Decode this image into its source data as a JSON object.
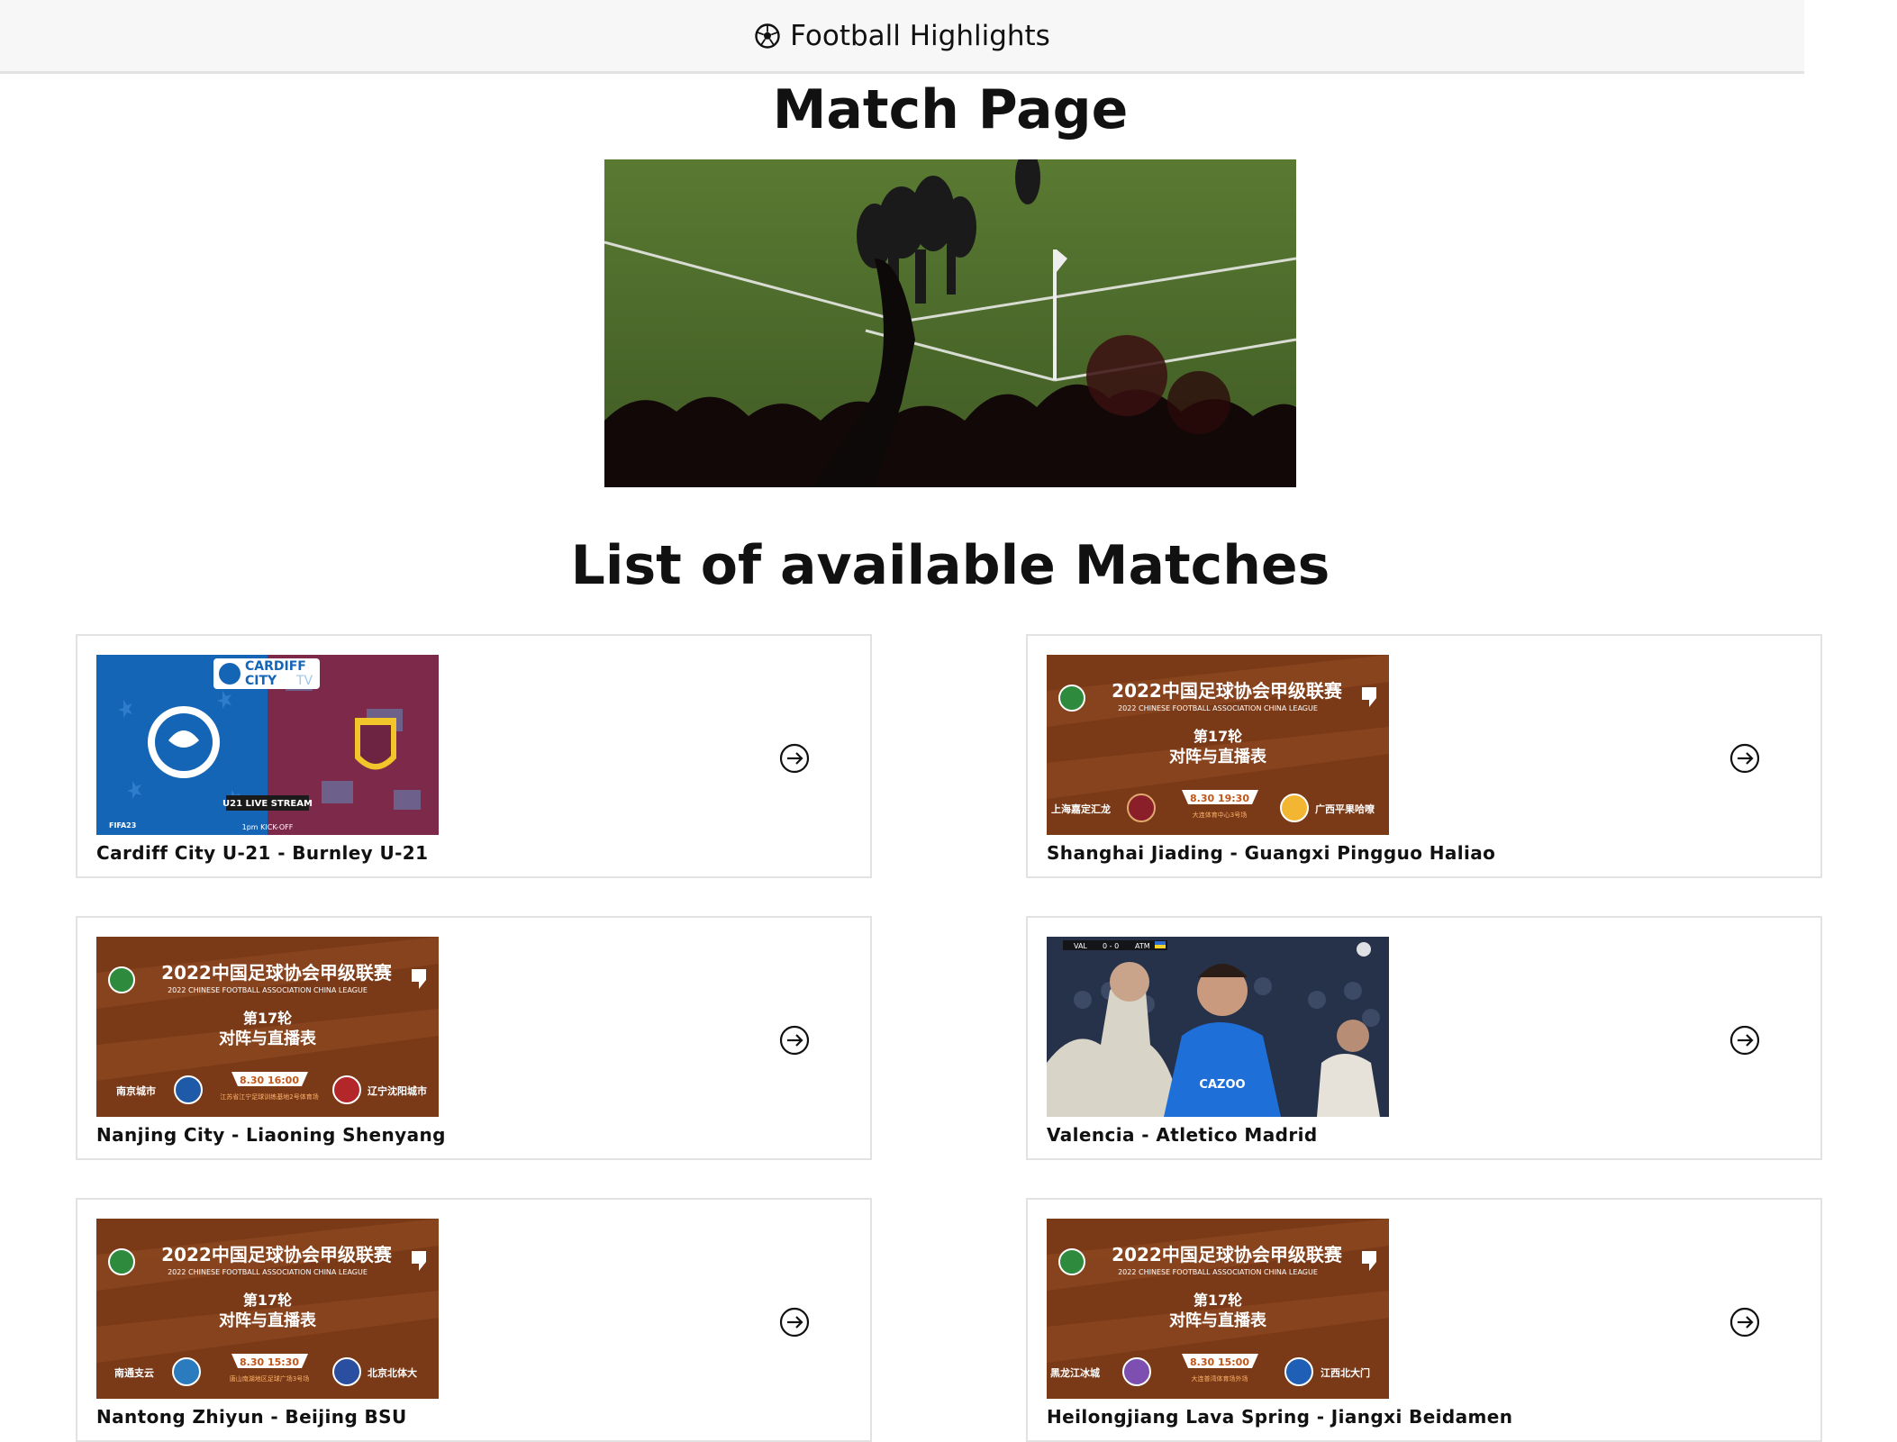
{
  "header": {
    "title": "Football Highlights",
    "logo_icon": "football-icon"
  },
  "page_title": "Match Page",
  "list_title": "List of available Matches",
  "league_banner": {
    "cn_title": "2022中国足球协会甲级联赛",
    "en_title": "2022 CHINESE FOOTBALL ASSOCIATION CHINA LEAGUE",
    "round": "第17轮",
    "subtitle": "对阵与直播表"
  },
  "matches": [
    {
      "name": "Cardiff City U-21 - Burnley U-21",
      "thumb": {
        "brand_line1": "CARDIFF",
        "brand_line2": "CITY",
        "brand_tv": "TV",
        "stream_label": "U21 LIVE STREAM",
        "kickoff": "1pm KICK-OFF",
        "sponsor": "FIFA23"
      }
    },
    {
      "name": "Shanghai Jiading - Guangxi Pingguo Haliao",
      "thumb": {
        "home": "上海嘉定汇龙",
        "away": "广西平果哈嘹",
        "time": "8.30  19:30",
        "venue": "大连体育中心3号场"
      }
    },
    {
      "name": "Nanjing City - Liaoning Shenyang",
      "thumb": {
        "home": "南京城市",
        "away": "辽宁沈阳城市",
        "time": "8.30  16:00",
        "venue": "江苏省江宁足球训练基地2号体育场"
      }
    },
    {
      "name": "Valencia - Atletico Madrid",
      "thumb": {
        "score_home": "VAL",
        "score": "0 - 0",
        "score_away": "ATM",
        "sponsor": "CAZOO"
      }
    },
    {
      "name": "Nantong Zhiyun - Beijing BSU",
      "thumb": {
        "home": "南通支云",
        "away": "北京北体大",
        "time": "8.30  15:30",
        "venue": "唐山南湖地区足球广场3号场"
      }
    },
    {
      "name": "Heilongjiang Lava Spring - Jiangxi Beidamen",
      "thumb": {
        "home": "黑龙江冰城",
        "away": "江西北大门",
        "time": "8.30  15:00",
        "venue": "大连普湾体育场外场"
      }
    }
  ],
  "colors": {
    "accent_orange": "#ffb36b",
    "league_brown": "#7a3a18",
    "cardiff_blue": "#1565b7",
    "burnley_claret": "#7d2a4a"
  }
}
